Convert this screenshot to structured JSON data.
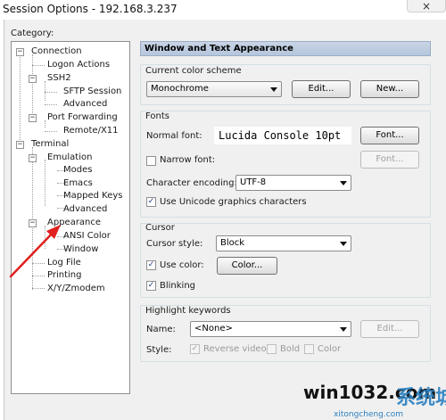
{
  "window": {
    "title": "Session Options - 192.168.3.237",
    "close_glyph": "×"
  },
  "category_label": "Category:",
  "tree": {
    "items": [
      {
        "label": "Connection",
        "expander": "−"
      },
      {
        "label": "Logon Actions"
      },
      {
        "label": "SSH2",
        "expander": "−"
      },
      {
        "label": "SFTP Session"
      },
      {
        "label": "Advanced"
      },
      {
        "label": "Port Forwarding",
        "expander": "−"
      },
      {
        "label": "Remote/X11"
      },
      {
        "label": "Terminal",
        "expander": "−"
      },
      {
        "label": "Emulation",
        "expander": "−"
      },
      {
        "label": "Modes"
      },
      {
        "label": "Emacs"
      },
      {
        "label": "Mapped Keys"
      },
      {
        "label": "Advanced"
      },
      {
        "label": "Appearance",
        "expander": "−"
      },
      {
        "label": "ANSI Color"
      },
      {
        "label": "Window"
      },
      {
        "label": "Log File"
      },
      {
        "label": "Printing"
      },
      {
        "label": "X/Y/Zmodem"
      }
    ]
  },
  "panel": {
    "header": "Window and Text Appearance",
    "color_scheme": {
      "title": "Current color scheme",
      "selected": "Monochrome",
      "edit_button": "Edit...",
      "new_button": "New..."
    },
    "fonts": {
      "title": "Fonts",
      "normal_font_label": "Normal font:",
      "normal_font_preview": "Lucida Console 10pt",
      "font_button": "Font...",
      "narrow_font_label": "Narrow font:",
      "narrow_font_checked": false,
      "narrow_font_button": "Font...",
      "encoding_label": "Character encoding:",
      "encoding_value": "UTF-8",
      "unicode_label": "Use Unicode graphics characters",
      "unicode_checked": true
    },
    "cursor": {
      "title": "Cursor",
      "style_label": "Cursor style:",
      "style_value": "Block",
      "use_color_label": "Use color:",
      "use_color_checked": true,
      "color_button": "Color...",
      "blinking_label": "Blinking",
      "blinking_checked": true
    },
    "highlight": {
      "title": "Highlight keywords",
      "name_label": "Name:",
      "name_value": "<None>",
      "edit_button": "Edit...",
      "style_label": "Style:",
      "reverse_label": "Reverse video",
      "reverse_checked": true,
      "bold_label": "Bold",
      "bold_checked": false,
      "color_label": "Color",
      "color_checked": false
    }
  },
  "check_glyph": "✓",
  "watermark": {
    "text": "win1032.com",
    "cn_text": "系统城",
    "domain": "xitongcheng.com"
  },
  "colors": {
    "annotation_arrow": "#e0201e",
    "header_bar": "#c3d1e3"
  }
}
